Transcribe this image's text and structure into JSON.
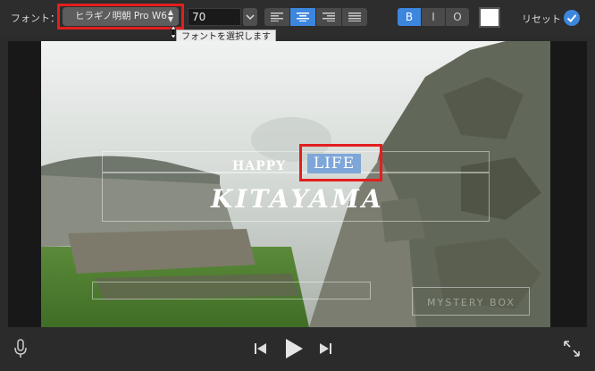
{
  "toolbar": {
    "font_label": "フォント：",
    "font_value": "ヒラギノ明朝 Pro W6",
    "size_value": "70",
    "style_bold": "B",
    "style_italic": "I",
    "style_outline": "O",
    "reset_label": "リセット",
    "text_color": "#ffffff",
    "accent_color": "#3d86dd"
  },
  "tooltip": {
    "text": "フォントを選択します"
  },
  "video": {
    "title_line1": "HAPPY",
    "title_highlight": "LIFE",
    "title_line2": "KITAYAMA",
    "watermark": "MYSTERY BOX"
  },
  "icons": {
    "microphone": "microphone-icon",
    "previous": "skip-back-icon",
    "play": "play-icon",
    "next": "skip-forward-icon",
    "fullscreen": "fullscreen-icon",
    "reset": "checkmark-icon"
  },
  "highlight_color": "#e21f1f"
}
